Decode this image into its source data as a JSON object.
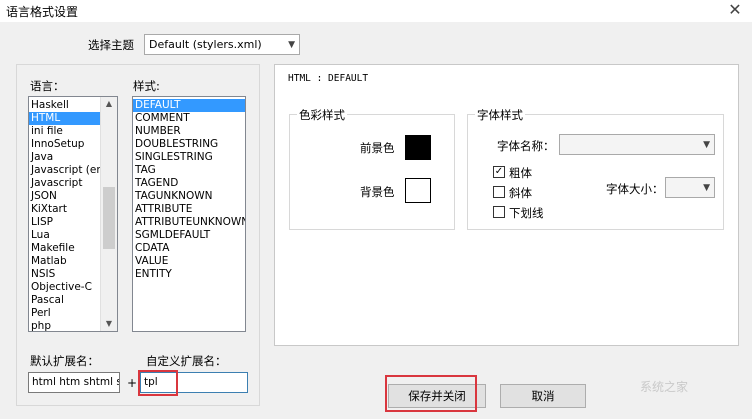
{
  "window": {
    "title": "语言格式设置",
    "close_glyph": "✕"
  },
  "theme": {
    "label": "选择主题",
    "selected": "Default (stylers.xml)"
  },
  "language": {
    "label": "语言：",
    "items": [
      "Haskell",
      "HTML",
      "ini file",
      "InnoSetup",
      "Java",
      "Javascript (en",
      "Javascript",
      "JSON",
      "KiXtart",
      "LISP",
      "Lua",
      "Makefile",
      "Matlab",
      "NSIS",
      "Objective-C",
      "Pascal",
      "Perl",
      "php"
    ],
    "selected_index": 1
  },
  "style": {
    "label": "样式:",
    "items": [
      "DEFAULT",
      "COMMENT",
      "NUMBER",
      "DOUBLESTRING",
      "SINGLESTRING",
      "TAG",
      "TAGEND",
      "TAGUNKNOWN",
      "ATTRIBUTE",
      "ATTRIBUTEUNKNOWN",
      "SGMLDEFAULT",
      "CDATA",
      "VALUE",
      "ENTITY"
    ],
    "selected_index": 0
  },
  "preview": {
    "header": "HTML : DEFAULT"
  },
  "color_group": {
    "title": "色彩样式",
    "fg_label": "前景色",
    "fg_color": "#000000",
    "bg_label": "背景色",
    "bg_color": "#ffffff"
  },
  "font_group": {
    "title": "字体样式",
    "name_label": "字体名称：",
    "name_value": "",
    "bold_label": "粗体",
    "bold_checked": true,
    "italic_label": "斜体",
    "italic_checked": false,
    "underline_label": "下划线",
    "underline_checked": false,
    "size_label": "字体大小：",
    "size_value": ""
  },
  "ext": {
    "default_label": "默认扩展名：",
    "default_value": "html htm shtml sht",
    "plus": "+",
    "custom_label": "自定义扩展名：",
    "custom_value": "tpl"
  },
  "buttons": {
    "save_close": "保存并关闭",
    "cancel": "取消"
  },
  "watermark": "系统之家",
  "colors": {
    "selection": "#3399ff",
    "highlight_red": "#d9363e"
  }
}
